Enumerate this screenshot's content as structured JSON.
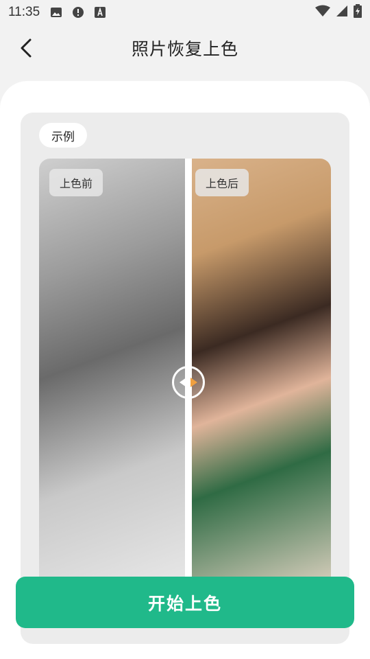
{
  "status_bar": {
    "time": "11:35"
  },
  "header": {
    "title": "照片恢复上色"
  },
  "example": {
    "label": "示例",
    "before_label": "上色前",
    "after_label": "上色后"
  },
  "action": {
    "start_label": "开始上色"
  },
  "colors": {
    "accent": "#20b98a",
    "card_bg": "#ececec",
    "page_bg": "#f2f2f2"
  }
}
